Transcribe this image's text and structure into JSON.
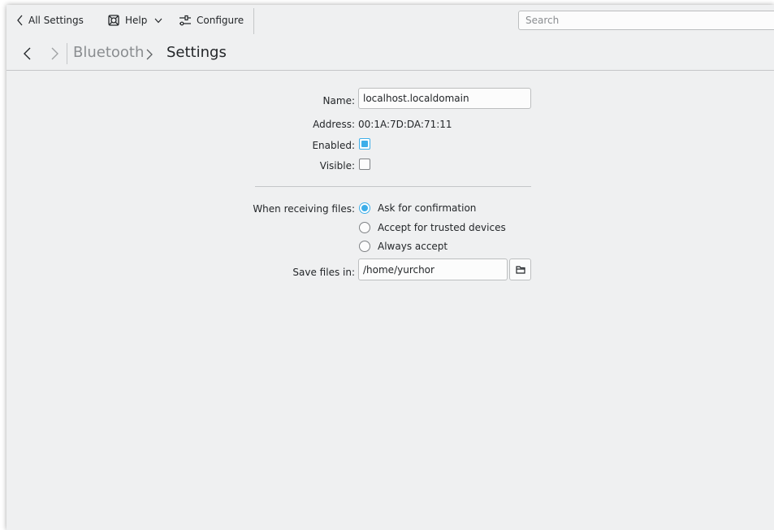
{
  "toolbar": {
    "all_settings_label": "All Settings",
    "help_label": "Help",
    "configure_label": "Configure",
    "search_placeholder": "Search"
  },
  "header": {
    "breadcrumb_parent": "Bluetooth",
    "breadcrumb_current": "Settings"
  },
  "form": {
    "name_label": "Name:",
    "name_value": "localhost.localdomain",
    "address_label": "Address:",
    "address_value": "00:1A:7D:DA:71:11",
    "enabled_label": "Enabled:",
    "enabled_checked": true,
    "visible_label": "Visible:",
    "visible_checked": false,
    "receiving_label": "When receiving files:",
    "receiving_options": [
      {
        "label": "Ask for confirmation",
        "selected": true
      },
      {
        "label": "Accept for trusted devices",
        "selected": false
      },
      {
        "label": "Always accept",
        "selected": false
      }
    ],
    "save_label": "Save files in:",
    "save_path": "/home/yurchor"
  },
  "colors": {
    "accent": "#3daee9",
    "window_bg": "#eff0f1",
    "text": "#232629",
    "muted_text": "#8a8d90"
  },
  "icons": {
    "back": "chevron-left-icon",
    "help": "help-lifebuoy-icon",
    "help_menu": "chevron-down-icon",
    "configure": "configure-sliders-icon",
    "nav_back": "arrow-left-icon",
    "nav_forward": "arrow-right-icon",
    "breadcrumb_sep": "chevron-right-icon",
    "browse": "folder-icon"
  }
}
